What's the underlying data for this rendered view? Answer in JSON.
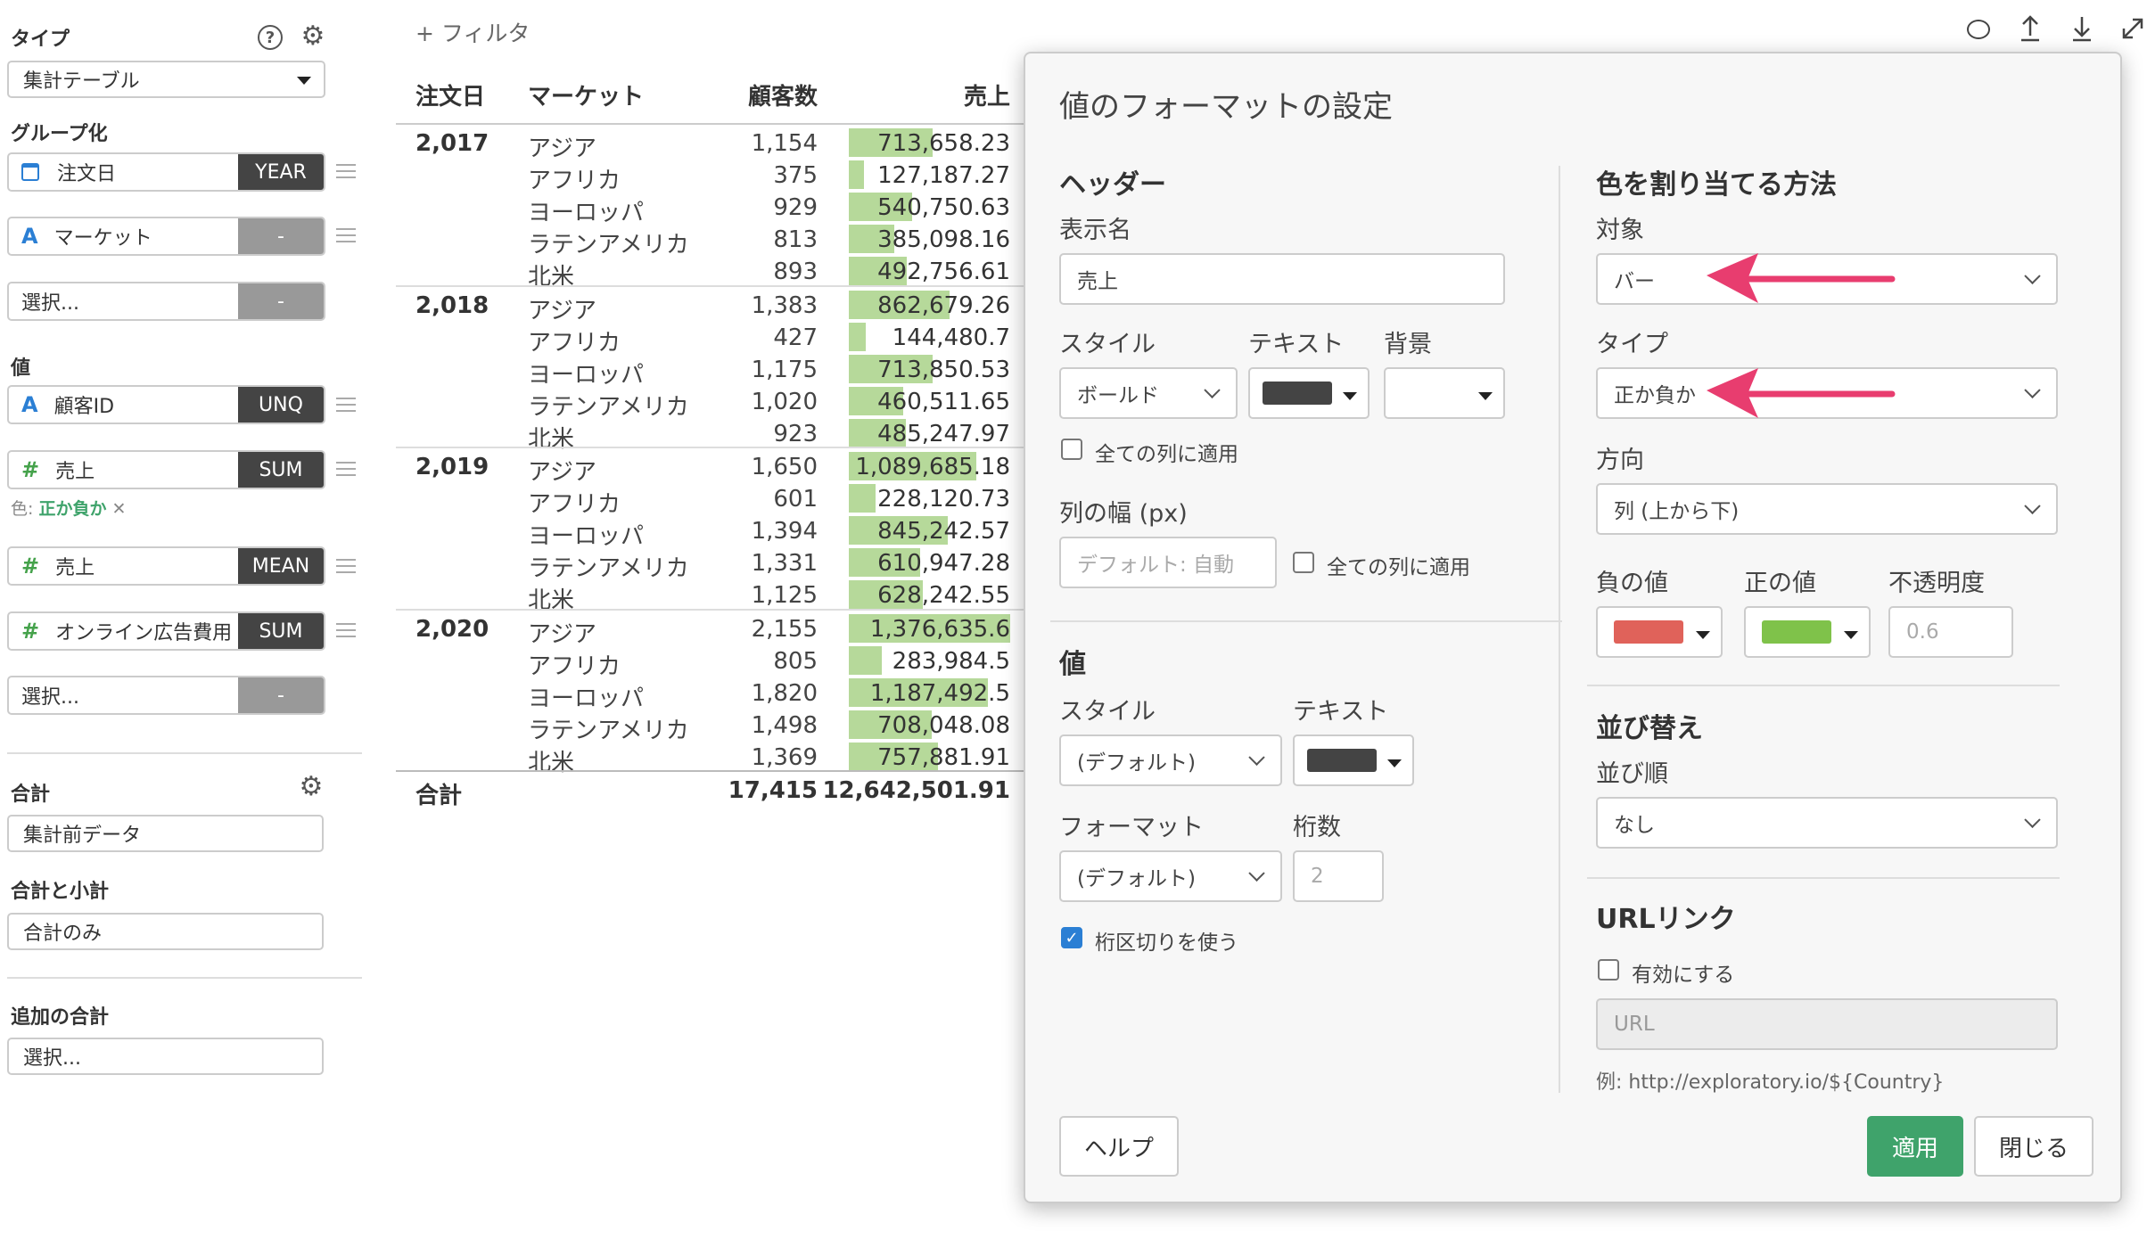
{
  "left": {
    "type_title": "タイプ",
    "type_value": "集計テーブル",
    "group_title": "グループ化",
    "groups": [
      {
        "icon": "calendar-icon",
        "label": "注文日",
        "agg": "YEAR"
      },
      {
        "icon": "text-type-icon",
        "label": "マーケット",
        "agg": "-"
      },
      {
        "icon": "",
        "label": "選択...",
        "agg": "-"
      }
    ],
    "value_title": "値",
    "values": [
      {
        "icon": "text-type-icon",
        "label": "顧客ID",
        "agg": "UNQ"
      },
      {
        "icon": "number-type-icon",
        "label": "売上",
        "agg": "SUM"
      },
      {
        "icon": "number-type-icon",
        "label": "売上",
        "agg": "MEAN"
      },
      {
        "icon": "number-type-icon",
        "label": "オンライン広告費用",
        "agg": "SUM"
      },
      {
        "icon": "",
        "label": "選択...",
        "agg": "-"
      }
    ],
    "color_prefix": "色:",
    "color_value": "正か負か",
    "color_remove": "✕",
    "total_title": "合計",
    "total_value": "集計前データ",
    "subtotal_title": "合計と小計",
    "subtotal_value": "合計のみ",
    "extra_title": "追加の合計",
    "extra_value": "選択..."
  },
  "filter_label": "+ フィルタ",
  "table": {
    "headers": [
      "注文日",
      "マーケット",
      "顧客数",
      "売上"
    ],
    "groups": [
      {
        "year": "2,017",
        "rows": [
          {
            "market": "アジア",
            "count": "1,154",
            "sales": "713,658.23",
            "bar": 0.518
          },
          {
            "market": "アフリカ",
            "count": "375",
            "sales": "127,187.27",
            "bar": 0.092
          },
          {
            "market": "ヨーロッパ",
            "count": "929",
            "sales": "540,750.63",
            "bar": 0.393
          },
          {
            "market": "ラテンアメリカ",
            "count": "813",
            "sales": "385,098.16",
            "bar": 0.28
          },
          {
            "market": "北米",
            "count": "893",
            "sales": "492,756.61",
            "bar": 0.358
          }
        ]
      },
      {
        "year": "2,018",
        "rows": [
          {
            "market": "アジア",
            "count": "1,383",
            "sales": "862,679.26",
            "bar": 0.627
          },
          {
            "market": "アフリカ",
            "count": "427",
            "sales": "144,480.7",
            "bar": 0.105
          },
          {
            "market": "ヨーロッパ",
            "count": "1,175",
            "sales": "713,850.53",
            "bar": 0.519
          },
          {
            "market": "ラテンアメリカ",
            "count": "1,020",
            "sales": "460,511.65",
            "bar": 0.335
          },
          {
            "market": "北米",
            "count": "923",
            "sales": "485,247.97",
            "bar": 0.352
          }
        ]
      },
      {
        "year": "2,019",
        "rows": [
          {
            "market": "アジア",
            "count": "1,650",
            "sales": "1,089,685.18",
            "bar": 0.792
          },
          {
            "market": "アフリカ",
            "count": "601",
            "sales": "228,120.73",
            "bar": 0.166
          },
          {
            "market": "ヨーロッパ",
            "count": "1,394",
            "sales": "845,242.57",
            "bar": 0.614
          },
          {
            "market": "ラテンアメリカ",
            "count": "1,331",
            "sales": "610,947.28",
            "bar": 0.444
          },
          {
            "market": "北米",
            "count": "1,125",
            "sales": "628,242.55",
            "bar": 0.456
          }
        ]
      },
      {
        "year": "2,020",
        "rows": [
          {
            "market": "アジア",
            "count": "2,155",
            "sales": "1,376,635.6",
            "bar": 1.0
          },
          {
            "market": "アフリカ",
            "count": "805",
            "sales": "283,984.5",
            "bar": 0.206
          },
          {
            "market": "ヨーロッパ",
            "count": "1,820",
            "sales": "1,187,492.5",
            "bar": 0.863
          },
          {
            "market": "ラテンアメリカ",
            "count": "1,498",
            "sales": "708,048.08",
            "bar": 0.514
          },
          {
            "market": "北米",
            "count": "1,369",
            "sales": "757,881.91",
            "bar": 0.551
          }
        ]
      }
    ],
    "total_label": "合計",
    "total_count": "17,415",
    "total_sales": "12,642,501.91",
    "bar_color": "#b6d99a"
  },
  "dialog": {
    "title": "値のフォーマットの設定",
    "header_section": "ヘッダー",
    "display_name_label": "表示名",
    "display_name_value": "売上",
    "style_label": "スタイル",
    "style_value": "ボールド",
    "text_label": "テキスト",
    "bg_label": "背景",
    "header_text_color": "#444444",
    "apply_all_1": "全ての列に適用",
    "col_width_label": "列の幅 (px)",
    "col_width_placeholder": "デフォルト: 自動",
    "apply_all_2": "全ての列に適用",
    "value_section": "値",
    "value_style_label": "スタイル",
    "value_style_value": "(デフォルト)",
    "value_text_label": "テキスト",
    "value_text_color": "#444444",
    "format_label": "フォーマット",
    "format_value": "(デフォルト)",
    "digits_label": "桁数",
    "digits_placeholder": "2",
    "separator_label": "桁区切りを使う",
    "color_section": "色を割り当てる方法",
    "target_label": "対象",
    "target_value": "バー",
    "type_label": "タイプ",
    "type_value": "正か負か",
    "direction_label": "方向",
    "direction_value": "列 (上から下)",
    "neg_label": "負の値",
    "neg_color": "#e0625a",
    "pos_label": "正の値",
    "pos_color": "#7fc24a",
    "opacity_label": "不透明度",
    "opacity_placeholder": "0.6",
    "sort_section": "並び替え",
    "sort_order_label": "並び順",
    "sort_order_value": "なし",
    "url_section": "URLリンク",
    "url_enable_label": "有効にする",
    "url_placeholder": "URL",
    "url_example": "例: http://exploratory.io/${Country}",
    "help_button": "ヘルプ",
    "apply_button": "適用",
    "close_button": "閉じる"
  },
  "accent": "#3fa36b",
  "arrow_color": "#e83d6f"
}
